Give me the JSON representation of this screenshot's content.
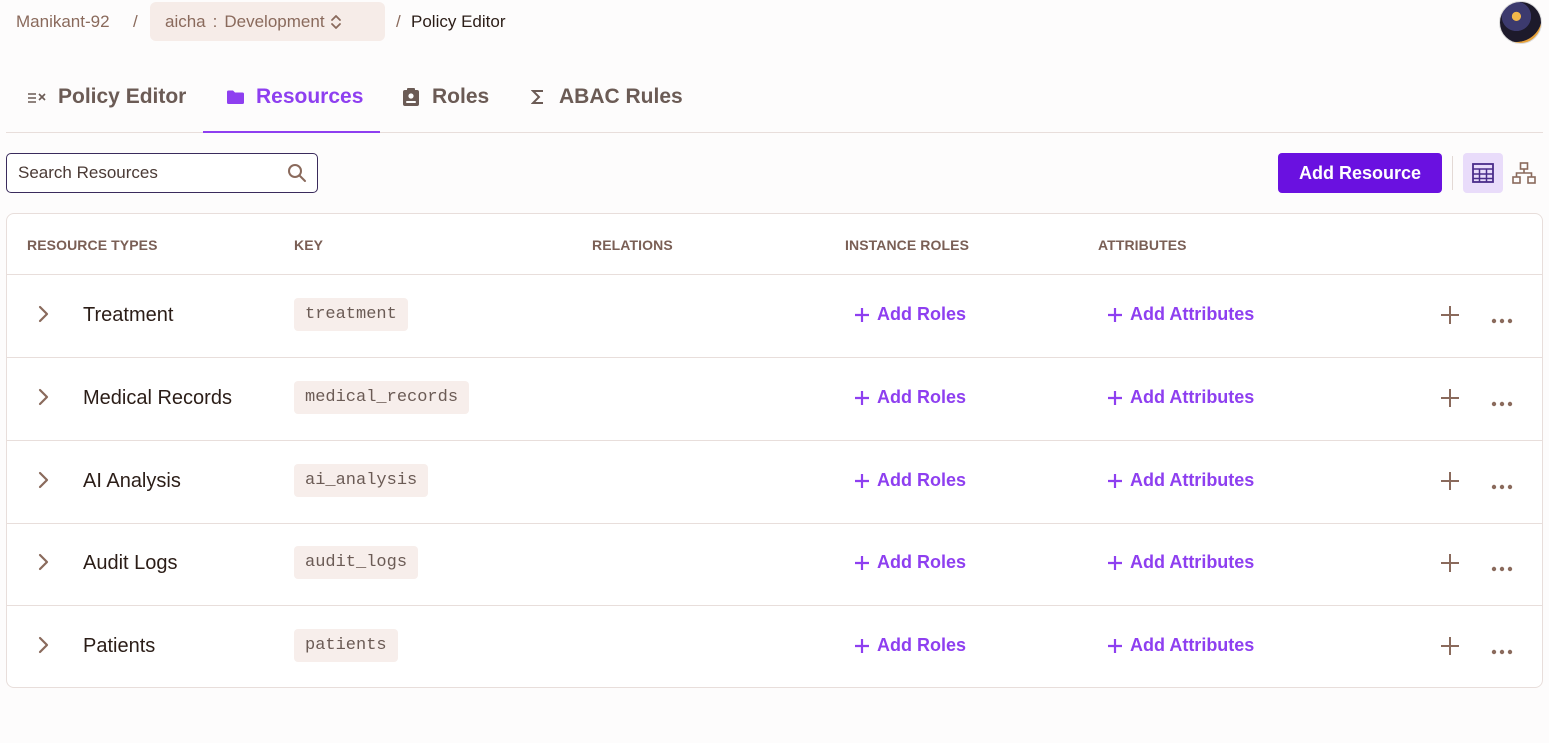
{
  "breadcrumb": {
    "org": "Manikant-92",
    "separator": "/",
    "project": "aicha",
    "project_sep": ":",
    "environment": "Development",
    "page": "Policy Editor"
  },
  "tabs": [
    {
      "label": "Policy Editor",
      "icon": "policy-icon"
    },
    {
      "label": "Resources",
      "icon": "folder-icon",
      "active": true
    },
    {
      "label": "Roles",
      "icon": "id-badge-icon"
    },
    {
      "label": "ABAC Rules",
      "icon": "sigma-icon"
    }
  ],
  "search": {
    "placeholder": "Search Resources",
    "value": ""
  },
  "toolbar": {
    "add_resource_label": "Add Resource"
  },
  "colors": {
    "accent": "#8e3ff0",
    "primary_button": "#6a11e0",
    "muted": "#8a6a5c"
  },
  "table": {
    "columns": [
      "RESOURCE TYPES",
      "KEY",
      "RELATIONS",
      "INSTANCE ROLES",
      "ATTRIBUTES"
    ],
    "add_roles_label": "Add Roles",
    "add_attributes_label": "Add Attributes",
    "rows": [
      {
        "name": "Treatment",
        "key": "treatment"
      },
      {
        "name": "Medical Records",
        "key": "medical_records"
      },
      {
        "name": "AI Analysis",
        "key": "ai_analysis"
      },
      {
        "name": "Audit Logs",
        "key": "audit_logs"
      },
      {
        "name": "Patients",
        "key": "patients"
      }
    ]
  }
}
